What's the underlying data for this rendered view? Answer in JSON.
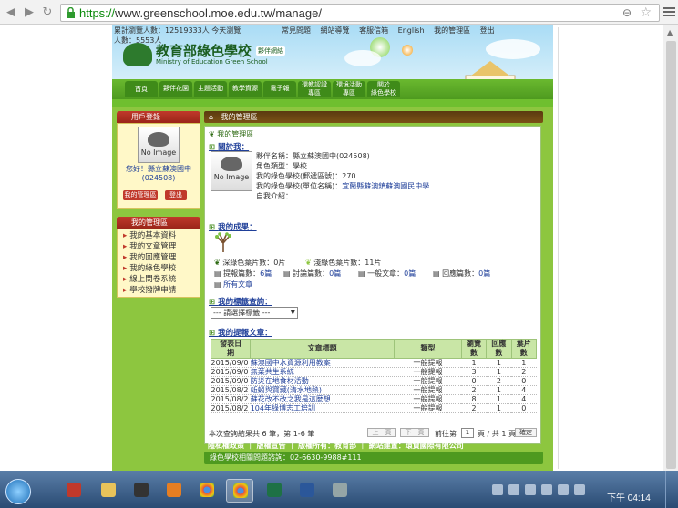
{
  "browser": {
    "url_scheme": "https://",
    "url_rest": "www.greenschool.moe.edu.tw/manage/"
  },
  "site": {
    "stats": [
      "累計瀏覽人數：12519333人 今天瀏覽",
      "人數：5553人"
    ],
    "top_links": [
      "常見問題",
      "網站導覽",
      "客服信箱",
      "English",
      "我的管理區",
      "登出"
    ],
    "logo_title": "教育部綠色學校",
    "logo_sub": "Ministry of Education Green School",
    "logo_badge": "夥伴網絡",
    "tabs": [
      "首頁",
      "夥伴花園",
      "主題活動",
      "教學資源",
      "電子報",
      "環教認證\n專區",
      "環境活動\n專區",
      "關於\n綠色學校"
    ]
  },
  "sidebar": {
    "login_title": "用戶登錄",
    "avatar_text": "No Image",
    "greeting": "您好！縣立蘇澳國中(024508)",
    "btn_manage": "我的管理區",
    "btn_logout": "登出",
    "manage_title": "我的管理區",
    "manage_items": [
      "我的基本資料",
      "我的文章管理",
      "我的回應管理",
      "我的綠色學校",
      "線上問卷系統",
      "學校撥牌申請"
    ]
  },
  "main": {
    "breadcrumb": "我的管理區",
    "section_header": "我的管理區",
    "about_title": "關於我：",
    "avatar_text": "No Image",
    "fields": [
      {
        "label": "夥伴名稱：",
        "value": "縣立蘇澳國中(024508)"
      },
      {
        "label": "角色類型：",
        "value": "學校"
      },
      {
        "label": "我的綠色學校(郵遞區號)：",
        "value": "270"
      },
      {
        "label": "我的綠色學校(單位名稱)：",
        "value": "宜蘭縣蘇澳鎮蘇澳國民中學"
      },
      {
        "label": "自我介紹：",
        "value": ""
      }
    ],
    "intro_dots": "...",
    "results_title": "我的成果：",
    "deep_leaves": "深綠色葉片數：",
    "deep_leaves_val": "0片",
    "light_leaves": "淺綠色葉片數：",
    "light_leaves_val": "11片",
    "counts": [
      {
        "label": "提報篇數：",
        "value": "6篇"
      },
      {
        "label": "討論篇數：",
        "value": "0篇"
      },
      {
        "label": "一般文章：",
        "value": "0篇"
      },
      {
        "label": "回應篇數：",
        "value": "0篇"
      }
    ],
    "all_articles": "所有文章",
    "tags_title": "我的標籤查詢：",
    "tags_select": "--- 請選擇標籤 ---",
    "posts_title": "我的提報文章：",
    "table_headers": [
      "發表日\n期",
      "文章標題",
      "類型",
      "瀏覽\n數",
      "回應\n數",
      "葉片\n數"
    ],
    "rows": [
      [
        "2015/09/0",
        "蘇澳國中水資源利用教案",
        "一般提報",
        "1",
        "1",
        "1"
      ],
      [
        "2015/09/0",
        "無菜共生系統",
        "一般提報",
        "3",
        "1",
        "2"
      ],
      [
        "2015/09/0",
        "防災在地食材活動",
        "一般提報",
        "0",
        "2",
        "0"
      ],
      [
        "2015/08/2",
        "蚯蚓與寶藏(清水地熱)",
        "一般提報",
        "2",
        "1",
        "4"
      ],
      [
        "2015/08/2",
        "蘇花改不改之我是這麼想",
        "一般提報",
        "8",
        "1",
        "4"
      ],
      [
        "2015/08/2",
        "104年綠博志工培訓",
        "一般提報",
        "2",
        "1",
        "0"
      ]
    ],
    "pager_text": "本次查詢結果共 6 筆，第 1-6 筆",
    "prev": "上一頁",
    "next": "下一頁",
    "goto": "前往第",
    "page_value": "1",
    "of_pages": "頁 / 共 1 頁",
    "confirm": "確定"
  },
  "footer": {
    "line1": "隱私權政策 ｜ 版權宣告 ｜ 版權所有：教育部 ｜ 網站建置：環資國際有限公司",
    "line2": "綠色學校相關問題諮詢：02-6630-9988#111"
  },
  "taskbar": {
    "clock": "下午 04:14"
  }
}
